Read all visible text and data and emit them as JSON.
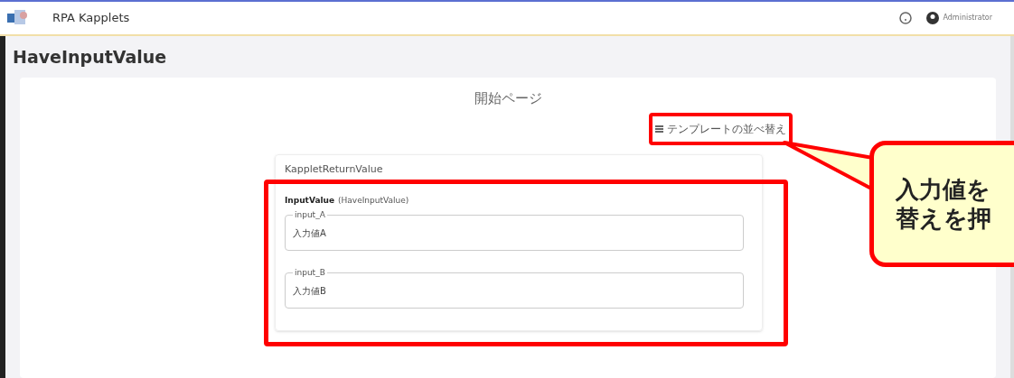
{
  "header": {
    "app_name": "RPA Kapplets",
    "user": "Administrator"
  },
  "page": {
    "title": "HaveInputValue",
    "heading": "開始ページ",
    "sort_button": "テンプレートの並べ替え"
  },
  "card": {
    "title": "KappletReturnValue",
    "section_label": "InputValue",
    "section_source": "(HaveInputValue)",
    "fields": [
      {
        "label": "input_A",
        "value": "入力値A"
      },
      {
        "label": "input_B",
        "value": "入力値B"
      }
    ]
  },
  "callout": {
    "lines": [
      "入力値を",
      "替えを押"
    ]
  }
}
